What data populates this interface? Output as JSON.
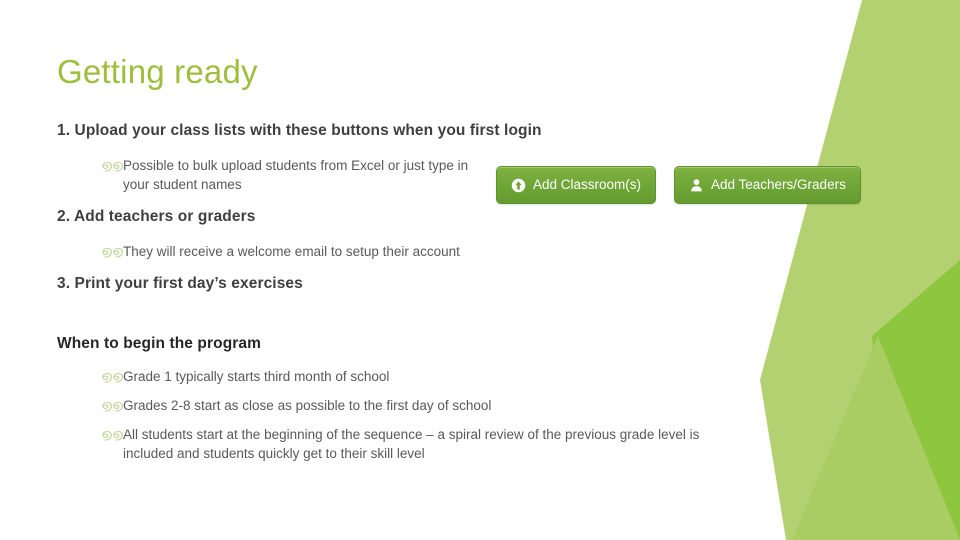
{
  "slide": {
    "title": "Getting ready",
    "title_color": "#9FBE3E",
    "background_color": "#FFFFFF",
    "accent_light": "#B4D171",
    "accent_mid": "#A7CA5F",
    "accent_dark": "#8DC63F"
  },
  "steps": [
    {
      "heading": "1. Upload your class lists with these buttons when you first login",
      "bullets": [
        "Possible to bulk upload students from Excel or just type in your student names"
      ]
    },
    {
      "heading": "2. Add teachers or graders",
      "bullets": [
        "They will receive a welcome email to setup their account"
      ]
    },
    {
      "heading": "3. Print your first day’s exercises",
      "bullets": []
    }
  ],
  "when_section": {
    "heading": "When to begin the program",
    "bullets": [
      "Grade 1 typically starts third month of school",
      "Grades 2-8 start as close as possible to the first day of school",
      "All students start at the beginning of the sequence – a spiral review of the previous grade level is included and students quickly get to their skill level"
    ]
  },
  "bullet_glyph": "൭൭",
  "buttons": [
    {
      "id": "add-classrooms",
      "label": "Add Classroom(s)",
      "icon": "upload-circle-icon",
      "color": "#6FA637"
    },
    {
      "id": "add-teachers",
      "label": "Add Teachers/Graders",
      "icon": "person-icon",
      "color": "#6FA637"
    }
  ]
}
